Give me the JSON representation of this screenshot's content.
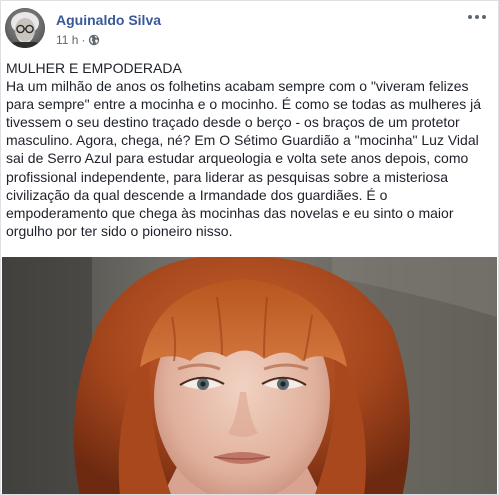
{
  "post": {
    "author": "Aguinaldo Silva",
    "timestamp": "11 h",
    "separator": "·",
    "privacy_icon": "globe-icon",
    "more_icon": "more-options-icon",
    "heading": "MULHER E EMPODERADA",
    "body": "Ha um milhão de anos os folhetins acabam sempre com o \"viveram felizes para sempre\" entre a mocinha e o mocinho. É como se todas as mulheres já tivessem o seu destino traçado desde o berço - os braços de um protetor masculino. Agora, chega, né? Em O Sétimo Guardião a \"mocinha\" Luz Vidal sai de Serro Azul para estudar arqueologia e volta sete anos depois, como profissional independente, para liderar as pesquisas sobre a misteriosa civilização da qual descende a Irmandade dos guardiães. É o empoderamento que chega às mocinhas das novelas e eu sinto o maior orgulho por ter sido o pioneiro nisso."
  },
  "colors": {
    "author_link": "#385898",
    "meta_text": "#616770",
    "body_text": "#1d2129",
    "card_border": "#dddfe2"
  }
}
